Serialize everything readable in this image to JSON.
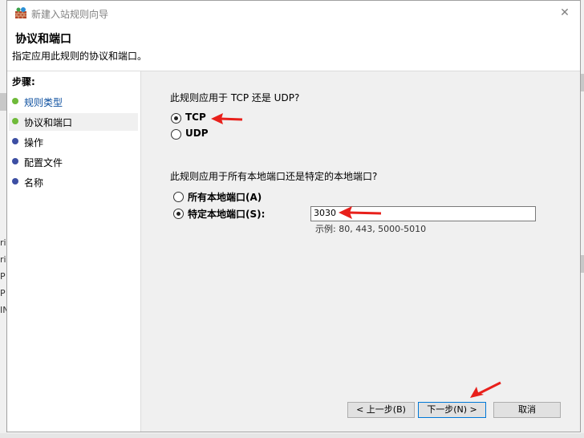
{
  "window": {
    "title": "新建入站规则向导",
    "icon": "firewall-rule-icon"
  },
  "header": {
    "title": "协议和端口",
    "subtitle": "指定应用此规则的协议和端口。"
  },
  "sidebar": {
    "heading": "步骤:",
    "items": [
      {
        "label": "规则类型",
        "status": "done"
      },
      {
        "label": "协议和端口",
        "status": "done"
      },
      {
        "label": "操作",
        "status": "todo"
      },
      {
        "label": "配置文件",
        "status": "todo"
      },
      {
        "label": "名称",
        "status": "todo"
      }
    ]
  },
  "protocol": {
    "question": "此规则应用于 TCP 还是 UDP?",
    "options": [
      {
        "label": "TCP",
        "selected": true
      },
      {
        "label": "UDP",
        "selected": false
      }
    ]
  },
  "ports": {
    "question": "此规则应用于所有本地端口还是特定的本地端口?",
    "options": [
      {
        "label": "所有本地端口(A)",
        "selected": false
      },
      {
        "label": "特定本地端口(S):",
        "selected": true
      }
    ],
    "value": "3030",
    "example": "示例: 80, 443, 5000-5010"
  },
  "buttons": {
    "back": "< 上一步(B)",
    "next": "下一步(N) >",
    "cancel": "取消"
  },
  "background": {
    "left_fragments": [
      "ri",
      "ri",
      "P",
      "P",
      "IN"
    ]
  },
  "colors": {
    "done_dot": "#6fba3a",
    "todo_dot": "#3d4fa3",
    "link": "#0b4e9e",
    "annotation_arrow": "#e8201b"
  }
}
